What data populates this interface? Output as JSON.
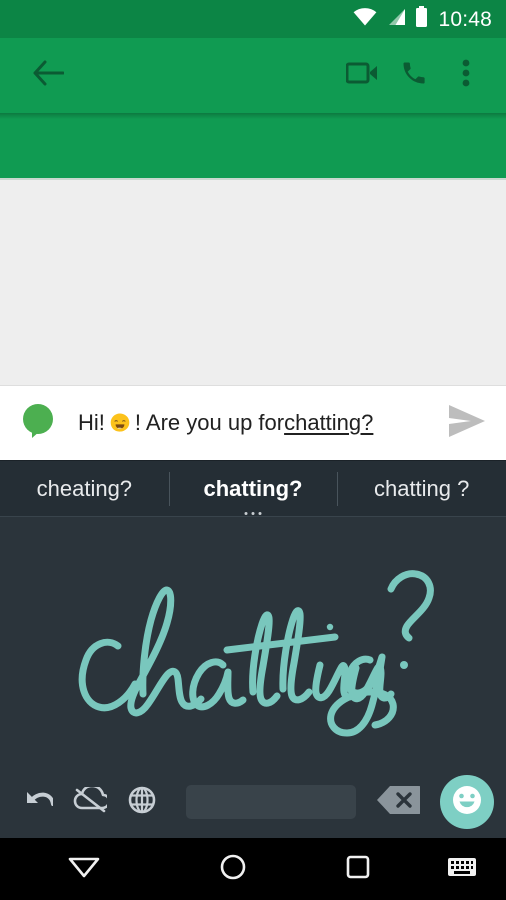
{
  "status_bar": {
    "time": "10:48",
    "icons": [
      "wifi-icon",
      "cellular-signal-icon",
      "battery-icon"
    ],
    "background_color": "#0c8545"
  },
  "action_bar": {
    "background_color": "#109B52",
    "icon_color": "#0b5b33",
    "back_icon": "arrow-back-icon",
    "actions": [
      {
        "name": "videocam-icon",
        "label": "Video call"
      },
      {
        "name": "call-icon",
        "label": "Call"
      },
      {
        "name": "overflow-icon",
        "label": "More options"
      }
    ]
  },
  "conversation": {
    "background_color": "#eeeeee",
    "messages": []
  },
  "compose": {
    "sms_icon": "speech-bubble-icon",
    "sms_icon_color": "#4caf50",
    "text_prefix": "Hi! ",
    "emoji": "smiling-blob-emoji",
    "text_middle": "! Are you up for ",
    "text_underlined": "chatting?",
    "full_text": "Hi! 😄! Are you up for chatting?",
    "send_icon": "send-icon",
    "send_icon_color": "#bdbdbd",
    "send_enabled": false
  },
  "suggestions": {
    "background_color": "#252e35",
    "items": [
      {
        "label": "cheating?",
        "selected": false,
        "has_dots": false
      },
      {
        "label": "chatting?",
        "selected": true,
        "has_dots": true
      },
      {
        "label": "chatting ?",
        "selected": false,
        "has_dots": false
      }
    ]
  },
  "handwriting": {
    "background_color": "#2b343b",
    "ink_color": "#79c7bd",
    "recognized_text": "chatting?",
    "description": "handwritten cursive word chatting with question mark"
  },
  "keyboard_toolbar": {
    "background_color": "#2b343b",
    "icon_color": "#c7ced4",
    "buttons": [
      {
        "name": "undo-icon",
        "label": "Undo"
      },
      {
        "name": "cloud-off-icon",
        "label": "Sync off"
      },
      {
        "name": "globe-icon",
        "label": "Change language"
      }
    ],
    "spacebar": {
      "name": "spacebar-key",
      "color": "#39434a"
    },
    "backspace": {
      "name": "backspace-icon",
      "color": "#8a949b"
    },
    "emoji_key": {
      "name": "emoji-icon",
      "background_color": "#7ecfc4",
      "glyph_color": "#ffffff"
    }
  },
  "nav_bar": {
    "background_color": "#000000",
    "buttons": [
      {
        "name": "nav-back-icon",
        "label": "Back / hide keyboard"
      },
      {
        "name": "nav-home-icon",
        "label": "Home"
      },
      {
        "name": "nav-recents-icon",
        "label": "Recent apps"
      },
      {
        "name": "nav-keyboard-switch-icon",
        "label": "Switch keyboard"
      }
    ]
  }
}
